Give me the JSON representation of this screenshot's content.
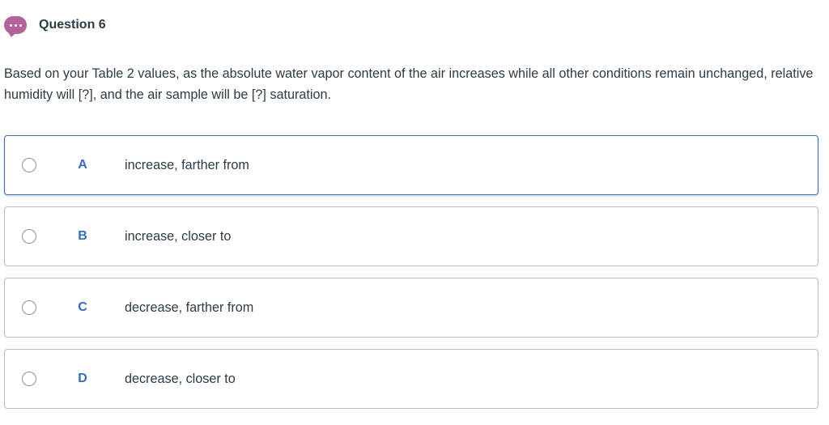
{
  "question": {
    "title": "Question 6",
    "prompt": "Based on your Table 2 values, as the absolute water vapor content of the air increases while all other conditions remain unchanged, relative humidity will [?], and the air sample will be [?] saturation.",
    "icon": "chat-bubble-ellipsis-icon",
    "icon_color": "#b5619c"
  },
  "options": [
    {
      "letter": "A",
      "text": "increase, farther from"
    },
    {
      "letter": "B",
      "text": "increase, closer to"
    },
    {
      "letter": "C",
      "text": "decrease, farther from"
    },
    {
      "letter": "D",
      "text": "decrease, closer to"
    }
  ],
  "colors": {
    "letter": "#2f6dcc",
    "focused_border": "#3a6fc4",
    "border": "#b7bdc3",
    "text": "#2d3b45"
  }
}
